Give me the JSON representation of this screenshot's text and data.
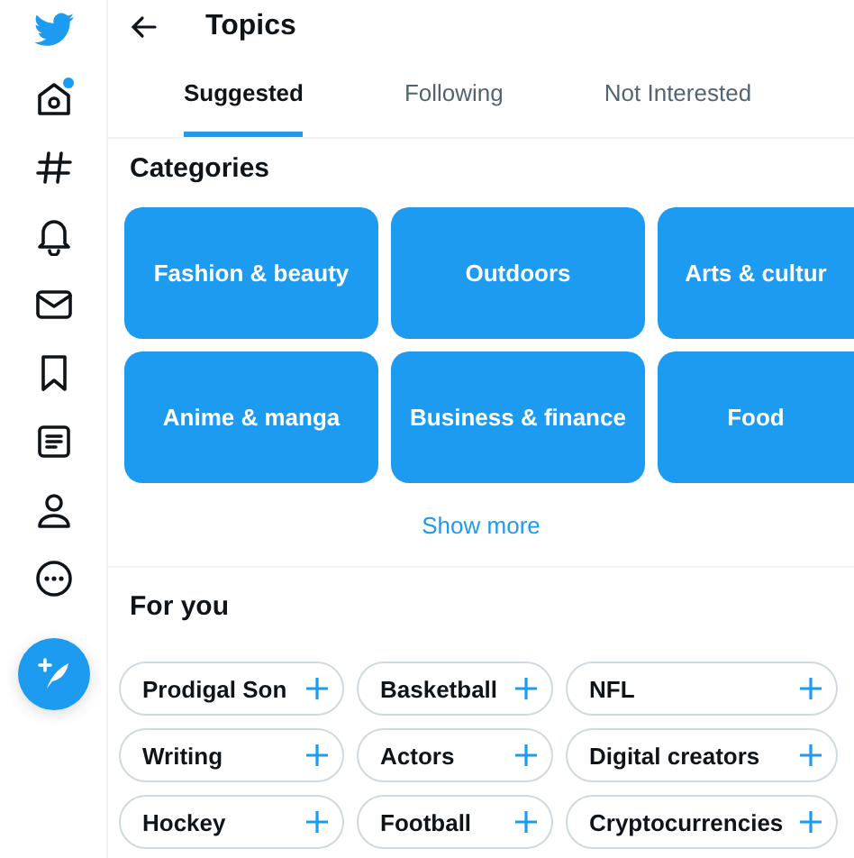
{
  "header": {
    "title": "Topics"
  },
  "tabs": [
    {
      "label": "Suggested",
      "selected": true
    },
    {
      "label": "Following",
      "selected": false
    },
    {
      "label": "Not Interested",
      "selected": false
    }
  ],
  "categories": {
    "heading": "Categories",
    "items": [
      "Fashion & beauty",
      "Outdoors",
      "Arts & cultur",
      "Anime & manga",
      "Business & finance",
      "Food"
    ],
    "show_more": "Show more"
  },
  "for_you": {
    "heading": "For you",
    "topics": [
      "Prodigal Son",
      "Basketball",
      "NFL",
      "Writing",
      "Actors",
      "Digital creators",
      "Hockey",
      "Football",
      "Cryptocurrencies"
    ]
  }
}
